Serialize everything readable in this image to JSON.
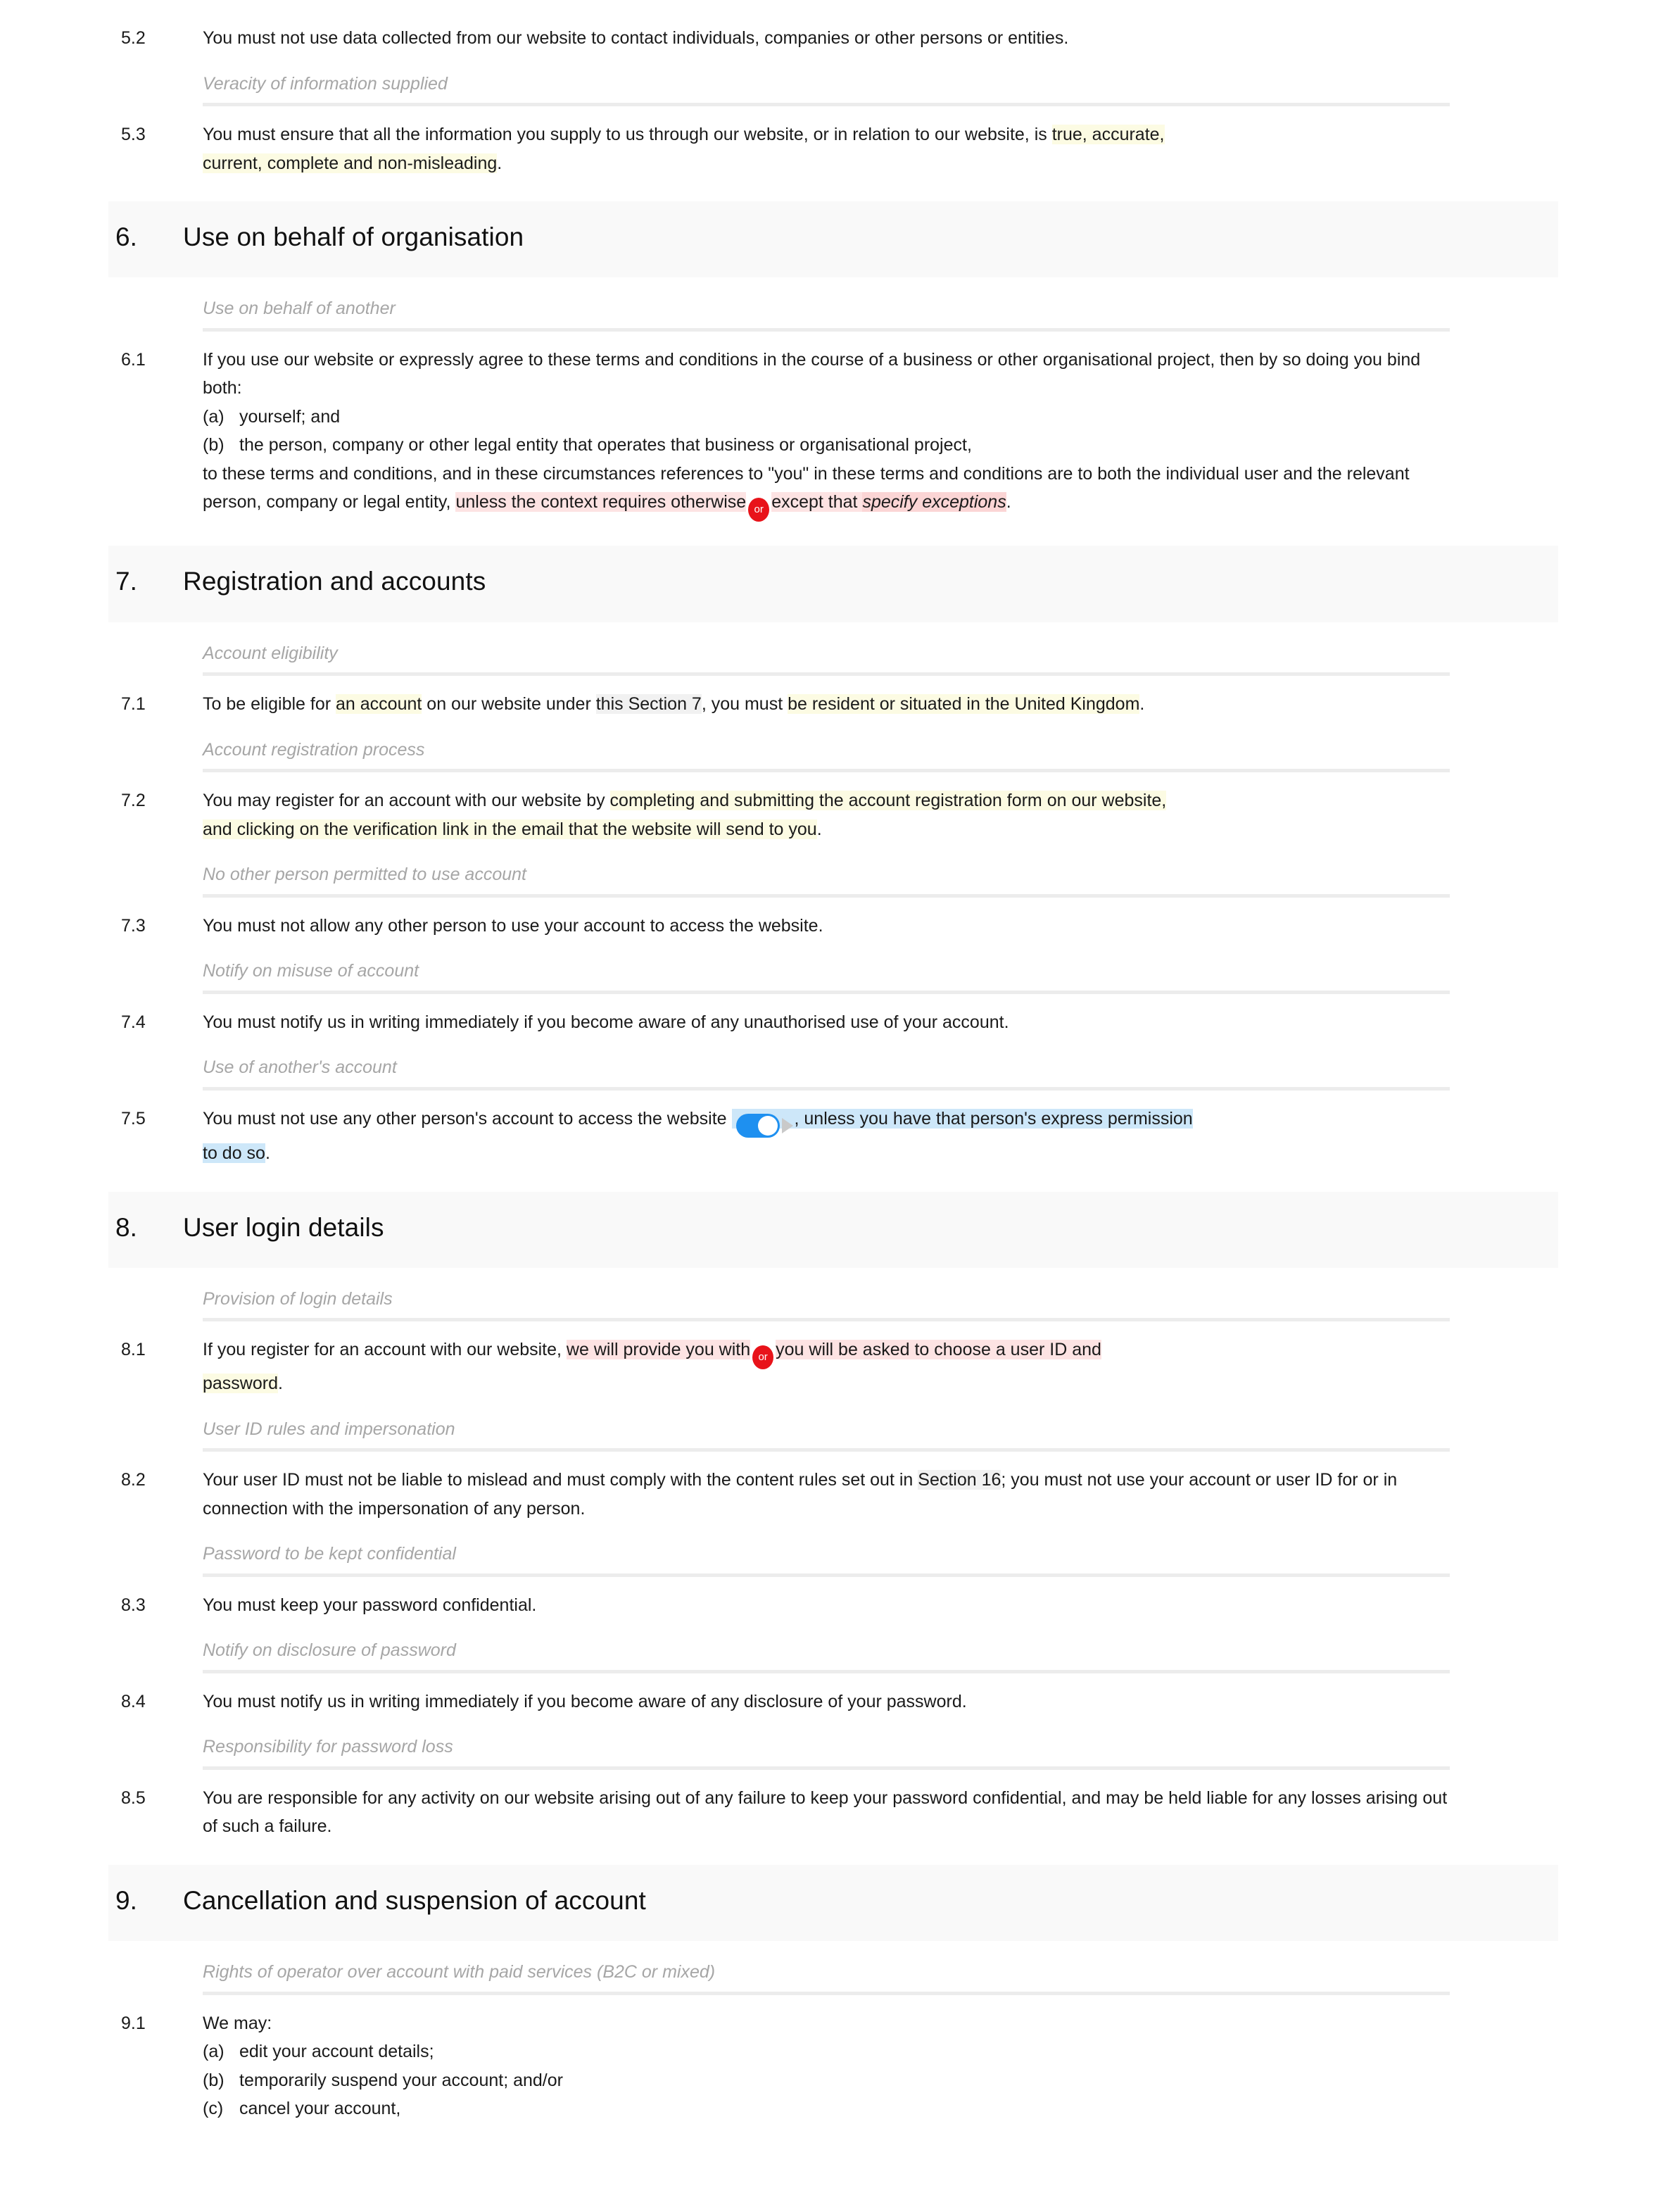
{
  "colors": {
    "highlight_yellow": "#fcfbe3",
    "highlight_pink": "#fde3e3",
    "highlight_pink_strong": "#fbd5d5",
    "highlight_blue": "#cde7f9",
    "highlight_grey": "#f1f1f1",
    "badge_red": "#e8131a",
    "toggle_blue": "#1e90f0",
    "section_band": "#f9f9f9",
    "rule_grey": "#ececec",
    "subhead_grey": "#a6a6a6",
    "body_text": "#1a1a1a"
  },
  "badges": {
    "or_label": "or"
  },
  "clauses": {
    "c52": {
      "num": "5.2",
      "text": "You must not use data collected from our website to contact individuals, companies or other persons or entities."
    },
    "c53": {
      "num": "5.3",
      "lead": "You must ensure that all the information you supply to us through our website, or in relation to our website, is ",
      "hl1": "true, accurate,",
      "hl2": "current, complete and non-misleading",
      "tail": "."
    },
    "c61": {
      "num": "6.1",
      "p1": "If you use our website or expressly agree to these terms and conditions in the course of a business or other organisational project, then by so doing you bind both:",
      "items": [
        {
          "label": "(a)",
          "text": "yourself; and"
        },
        {
          "label": "(b)",
          "text": "the person, company or other legal entity that operates that business or organisational project,"
        }
      ],
      "p2_lead": "to these terms and conditions, and in these circumstances references to \"you\" in these terms and conditions are to both the individual user and the relevant person, company or legal entity, ",
      "p2_hl1": "unless the context requires otherwise",
      "p2_hl2": "except that ",
      "p2_hl3": "specify exceptions",
      "p2_tail": "."
    },
    "c71": {
      "num": "7.1",
      "lead": "To be eligible for ",
      "hl1": "an account",
      "mid1": " on our website under ",
      "hl_ref": "this Section 7",
      "mid2": ", you must ",
      "hl2": "be resident or situated in the United Kingdom",
      "tail": "."
    },
    "c72": {
      "num": "7.2",
      "lead": "You may register for an account with our website by ",
      "hl1": "completing and submitting the account registration form on our website,",
      "hl2": "and clicking on the verification link in the email that the website will send to you",
      "tail": "."
    },
    "c73": {
      "num": "7.3",
      "text": "You must not allow any other person to use your account to access the website."
    },
    "c74": {
      "num": "7.4",
      "text": "You must notify us in writing immediately if you become aware of any unauthorised use of your account."
    },
    "c75": {
      "num": "7.5",
      "lead": "You must not use any other person's account to access the website ",
      "hl1": ", unless you have that person's express permission",
      "hl2": "to do so",
      "tail": "."
    },
    "c81": {
      "num": "8.1",
      "lead": "If you register for an account with our website, ",
      "hl1": "we will provide you with",
      "hl2": "you will be asked to choose a user ID and",
      "hl3": "password",
      "tail": "."
    },
    "c82": {
      "num": "8.2",
      "lead": "Your user ID must not be liable to mislead and must comply with the content rules set out in ",
      "hl_ref": "Section 16",
      "tail": "; you must not use your account or user ID for or in connection with the impersonation of any person."
    },
    "c83": {
      "num": "8.3",
      "text": "You must keep your password confidential."
    },
    "c84": {
      "num": "8.4",
      "text": "You must notify us in writing immediately if you become aware of any disclosure of your password."
    },
    "c85": {
      "num": "8.5",
      "text": "You are responsible for any activity on our website arising out of any failure to keep your password confidential, and may be held liable for any losses arising out of such a failure."
    },
    "c91": {
      "num": "9.1",
      "p1": "We may:",
      "items": [
        {
          "label": "(a)",
          "text": "edit your account details;"
        },
        {
          "label": "(b)",
          "text": "temporarily suspend your account; and/or"
        },
        {
          "label": "(c)",
          "text": "cancel your account,"
        }
      ]
    }
  },
  "subheads": {
    "s1": "Veracity of information supplied",
    "s2": "Use on behalf of another",
    "s3": "Account eligibility",
    "s4": "Account registration process",
    "s5": "No other person permitted to use account",
    "s6": "Notify on misuse of account",
    "s7": "Use of another's account",
    "s8": "Provision of login details",
    "s9": "User ID rules and impersonation",
    "s10": "Password to be kept confidential",
    "s11": "Notify on disclosure of password",
    "s12": "Responsibility for password loss",
    "s13": "Rights of operator over account with paid services (B2C or mixed)"
  },
  "sections": {
    "sec6": {
      "number": "6.",
      "title": "Use on behalf of organisation"
    },
    "sec7": {
      "number": "7.",
      "title": "Registration and accounts"
    },
    "sec8": {
      "number": "8.",
      "title": "User login details"
    },
    "sec9": {
      "number": "9.",
      "title": "Cancellation and suspension of account"
    }
  }
}
